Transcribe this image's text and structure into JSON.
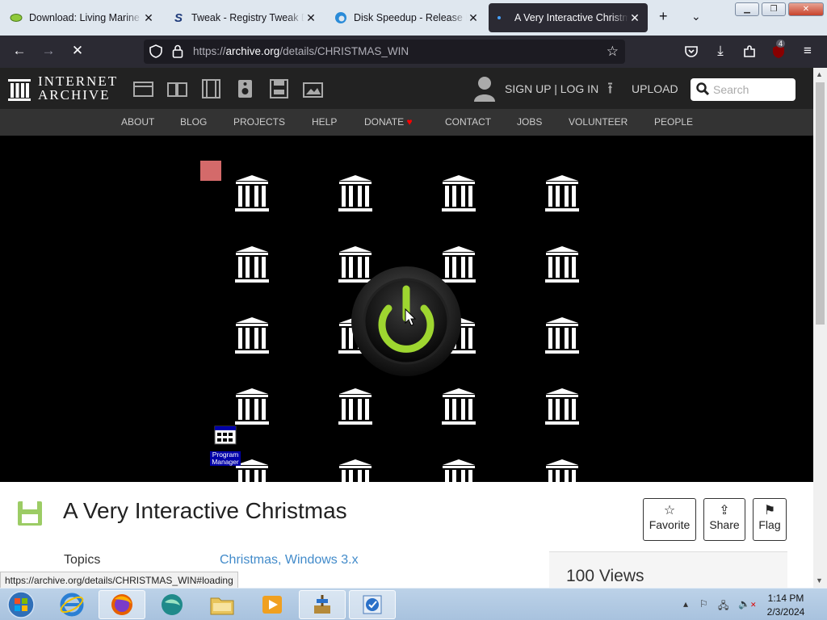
{
  "browser": {
    "tabs": [
      {
        "title": "Download: Living Marine A",
        "favicon": "green-oval-icon"
      },
      {
        "title": "Tweak - Registry Tweak Do",
        "favicon": "tweak-s-icon"
      },
      {
        "title": "Disk Speedup - Release No",
        "favicon": "edge-icon"
      },
      {
        "title": "A Very Interactive Christma",
        "favicon": "loading-dot-icon",
        "active": true
      }
    ],
    "url_prefix": "https://",
    "url_host": "archive.org",
    "url_path": "/details/CHRISTMAS_WIN",
    "extensions_badge": "4"
  },
  "ia_header": {
    "logo_line1": "INTERNET",
    "logo_line2": "ARCHIVE",
    "signup_label": "SIGN UP | LOG IN",
    "upload_label": "UPLOAD",
    "search_placeholder": "Search"
  },
  "topnav": [
    "ABOUT",
    "BLOG",
    "PROJECTS",
    "HELP",
    "DONATE",
    "CONTACT",
    "JOBS",
    "VOLUNTEER",
    "PEOPLE"
  ],
  "emulator": {
    "program_manager_label": "Program Manager"
  },
  "item": {
    "title": "A Very Interactive Christmas",
    "favorite_label": "Favorite",
    "share_label": "Share",
    "flag_label": "Flag",
    "topics_key": "Topics",
    "topics_value": "Christmas, Windows 3.x",
    "views": "100 Views"
  },
  "status_url": "https://archive.org/details/CHRISTMAS_WIN#loading",
  "taskbar": {
    "time": "1:14 PM",
    "date": "2/3/2024"
  },
  "colors": {
    "tab_active": "#2b2a33",
    "accent_link": "#428bca",
    "power_green": "#9ed630"
  }
}
